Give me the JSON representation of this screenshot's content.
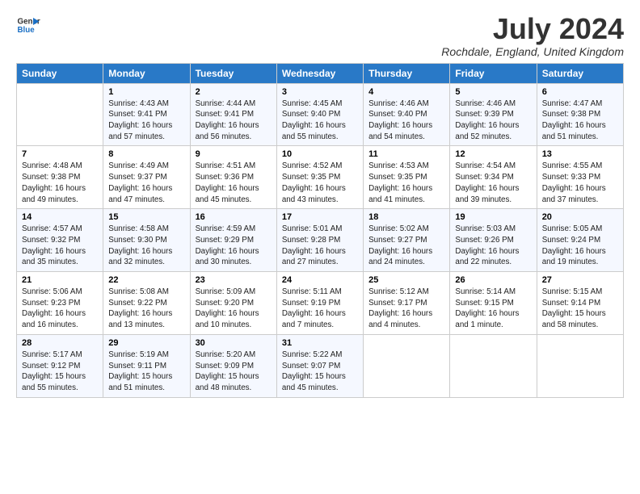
{
  "logo": {
    "line1": "General",
    "line2": "Blue"
  },
  "title": "July 2024",
  "location": "Rochdale, England, United Kingdom",
  "days_of_week": [
    "Sunday",
    "Monday",
    "Tuesday",
    "Wednesday",
    "Thursday",
    "Friday",
    "Saturday"
  ],
  "weeks": [
    [
      {
        "day": "",
        "sunrise": "",
        "sunset": "",
        "daylight": ""
      },
      {
        "day": "1",
        "sunrise": "Sunrise: 4:43 AM",
        "sunset": "Sunset: 9:41 PM",
        "daylight": "Daylight: 16 hours and 57 minutes."
      },
      {
        "day": "2",
        "sunrise": "Sunrise: 4:44 AM",
        "sunset": "Sunset: 9:41 PM",
        "daylight": "Daylight: 16 hours and 56 minutes."
      },
      {
        "day": "3",
        "sunrise": "Sunrise: 4:45 AM",
        "sunset": "Sunset: 9:40 PM",
        "daylight": "Daylight: 16 hours and 55 minutes."
      },
      {
        "day": "4",
        "sunrise": "Sunrise: 4:46 AM",
        "sunset": "Sunset: 9:40 PM",
        "daylight": "Daylight: 16 hours and 54 minutes."
      },
      {
        "day": "5",
        "sunrise": "Sunrise: 4:46 AM",
        "sunset": "Sunset: 9:39 PM",
        "daylight": "Daylight: 16 hours and 52 minutes."
      },
      {
        "day": "6",
        "sunrise": "Sunrise: 4:47 AM",
        "sunset": "Sunset: 9:38 PM",
        "daylight": "Daylight: 16 hours and 51 minutes."
      }
    ],
    [
      {
        "day": "7",
        "sunrise": "Sunrise: 4:48 AM",
        "sunset": "Sunset: 9:38 PM",
        "daylight": "Daylight: 16 hours and 49 minutes."
      },
      {
        "day": "8",
        "sunrise": "Sunrise: 4:49 AM",
        "sunset": "Sunset: 9:37 PM",
        "daylight": "Daylight: 16 hours and 47 minutes."
      },
      {
        "day": "9",
        "sunrise": "Sunrise: 4:51 AM",
        "sunset": "Sunset: 9:36 PM",
        "daylight": "Daylight: 16 hours and 45 minutes."
      },
      {
        "day": "10",
        "sunrise": "Sunrise: 4:52 AM",
        "sunset": "Sunset: 9:35 PM",
        "daylight": "Daylight: 16 hours and 43 minutes."
      },
      {
        "day": "11",
        "sunrise": "Sunrise: 4:53 AM",
        "sunset": "Sunset: 9:35 PM",
        "daylight": "Daylight: 16 hours and 41 minutes."
      },
      {
        "day": "12",
        "sunrise": "Sunrise: 4:54 AM",
        "sunset": "Sunset: 9:34 PM",
        "daylight": "Daylight: 16 hours and 39 minutes."
      },
      {
        "day": "13",
        "sunrise": "Sunrise: 4:55 AM",
        "sunset": "Sunset: 9:33 PM",
        "daylight": "Daylight: 16 hours and 37 minutes."
      }
    ],
    [
      {
        "day": "14",
        "sunrise": "Sunrise: 4:57 AM",
        "sunset": "Sunset: 9:32 PM",
        "daylight": "Daylight: 16 hours and 35 minutes."
      },
      {
        "day": "15",
        "sunrise": "Sunrise: 4:58 AM",
        "sunset": "Sunset: 9:30 PM",
        "daylight": "Daylight: 16 hours and 32 minutes."
      },
      {
        "day": "16",
        "sunrise": "Sunrise: 4:59 AM",
        "sunset": "Sunset: 9:29 PM",
        "daylight": "Daylight: 16 hours and 30 minutes."
      },
      {
        "day": "17",
        "sunrise": "Sunrise: 5:01 AM",
        "sunset": "Sunset: 9:28 PM",
        "daylight": "Daylight: 16 hours and 27 minutes."
      },
      {
        "day": "18",
        "sunrise": "Sunrise: 5:02 AM",
        "sunset": "Sunset: 9:27 PM",
        "daylight": "Daylight: 16 hours and 24 minutes."
      },
      {
        "day": "19",
        "sunrise": "Sunrise: 5:03 AM",
        "sunset": "Sunset: 9:26 PM",
        "daylight": "Daylight: 16 hours and 22 minutes."
      },
      {
        "day": "20",
        "sunrise": "Sunrise: 5:05 AM",
        "sunset": "Sunset: 9:24 PM",
        "daylight": "Daylight: 16 hours and 19 minutes."
      }
    ],
    [
      {
        "day": "21",
        "sunrise": "Sunrise: 5:06 AM",
        "sunset": "Sunset: 9:23 PM",
        "daylight": "Daylight: 16 hours and 16 minutes."
      },
      {
        "day": "22",
        "sunrise": "Sunrise: 5:08 AM",
        "sunset": "Sunset: 9:22 PM",
        "daylight": "Daylight: 16 hours and 13 minutes."
      },
      {
        "day": "23",
        "sunrise": "Sunrise: 5:09 AM",
        "sunset": "Sunset: 9:20 PM",
        "daylight": "Daylight: 16 hours and 10 minutes."
      },
      {
        "day": "24",
        "sunrise": "Sunrise: 5:11 AM",
        "sunset": "Sunset: 9:19 PM",
        "daylight": "Daylight: 16 hours and 7 minutes."
      },
      {
        "day": "25",
        "sunrise": "Sunrise: 5:12 AM",
        "sunset": "Sunset: 9:17 PM",
        "daylight": "Daylight: 16 hours and 4 minutes."
      },
      {
        "day": "26",
        "sunrise": "Sunrise: 5:14 AM",
        "sunset": "Sunset: 9:15 PM",
        "daylight": "Daylight: 16 hours and 1 minute."
      },
      {
        "day": "27",
        "sunrise": "Sunrise: 5:15 AM",
        "sunset": "Sunset: 9:14 PM",
        "daylight": "Daylight: 15 hours and 58 minutes."
      }
    ],
    [
      {
        "day": "28",
        "sunrise": "Sunrise: 5:17 AM",
        "sunset": "Sunset: 9:12 PM",
        "daylight": "Daylight: 15 hours and 55 minutes."
      },
      {
        "day": "29",
        "sunrise": "Sunrise: 5:19 AM",
        "sunset": "Sunset: 9:11 PM",
        "daylight": "Daylight: 15 hours and 51 minutes."
      },
      {
        "day": "30",
        "sunrise": "Sunrise: 5:20 AM",
        "sunset": "Sunset: 9:09 PM",
        "daylight": "Daylight: 15 hours and 48 minutes."
      },
      {
        "day": "31",
        "sunrise": "Sunrise: 5:22 AM",
        "sunset": "Sunset: 9:07 PM",
        "daylight": "Daylight: 15 hours and 45 minutes."
      },
      {
        "day": "",
        "sunrise": "",
        "sunset": "",
        "daylight": ""
      },
      {
        "day": "",
        "sunrise": "",
        "sunset": "",
        "daylight": ""
      },
      {
        "day": "",
        "sunrise": "",
        "sunset": "",
        "daylight": ""
      }
    ]
  ]
}
